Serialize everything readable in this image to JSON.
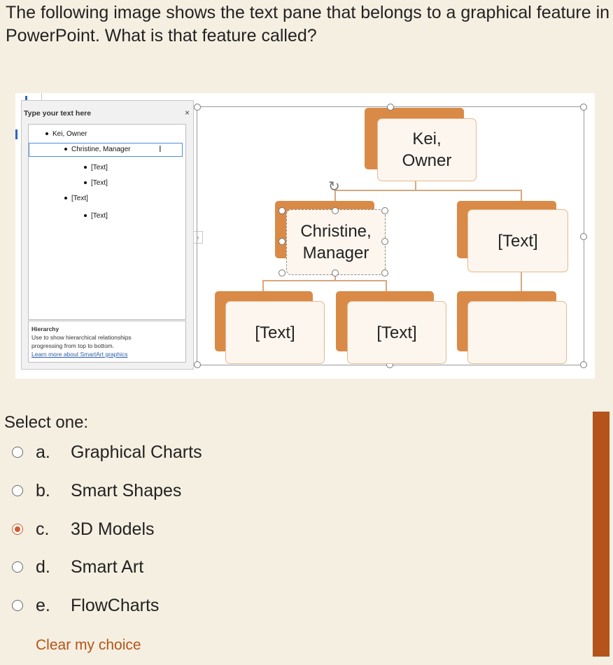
{
  "question": {
    "text": "The following image shows the text pane that belongs to a graphical feature in PowerPoint. What is that feature called?"
  },
  "screenshot": {
    "text_pane": {
      "title": "Type your text here",
      "close": "×",
      "items": [
        {
          "label": "Kei, Owner",
          "level": 1
        },
        {
          "label": "Christine, Manager",
          "level": 2
        },
        {
          "label": "[Text]",
          "level": 3
        },
        {
          "label": "[Text]",
          "level": 3
        },
        {
          "label": "[Text]",
          "level": 2
        },
        {
          "label": "[Text]",
          "level": 3
        }
      ],
      "info_title": "Hierarchy",
      "info_desc_1": "Use to show hierarchical relationships",
      "info_desc_2": "progressing from top to bottom.",
      "info_link": "Learn more about SmartArt graphics",
      "expander": "›"
    },
    "chart_boxes": {
      "top": "Kei,\nOwner",
      "mid_left": "Christine,\nManager",
      "mid_right": "[Text]",
      "bottom_1": "[Text]",
      "bottom_2": "[Text]",
      "bottom_3": ""
    },
    "colors": {
      "box_back": "#d98a47",
      "box_front": "#fdf6ee"
    }
  },
  "answers": {
    "prompt": "Select one:",
    "options": [
      {
        "letter": "a.",
        "text": "Graphical Charts",
        "checked": false
      },
      {
        "letter": "b.",
        "text": "Smart Shapes",
        "checked": false
      },
      {
        "letter": "c.",
        "text": "3D Models",
        "checked": true
      },
      {
        "letter": "d.",
        "text": "Smart Art",
        "checked": false
      },
      {
        "letter": "e.",
        "text": "FlowCharts",
        "checked": false
      }
    ],
    "clear_label": "Clear my choice",
    "accent": "#d35a2d"
  }
}
